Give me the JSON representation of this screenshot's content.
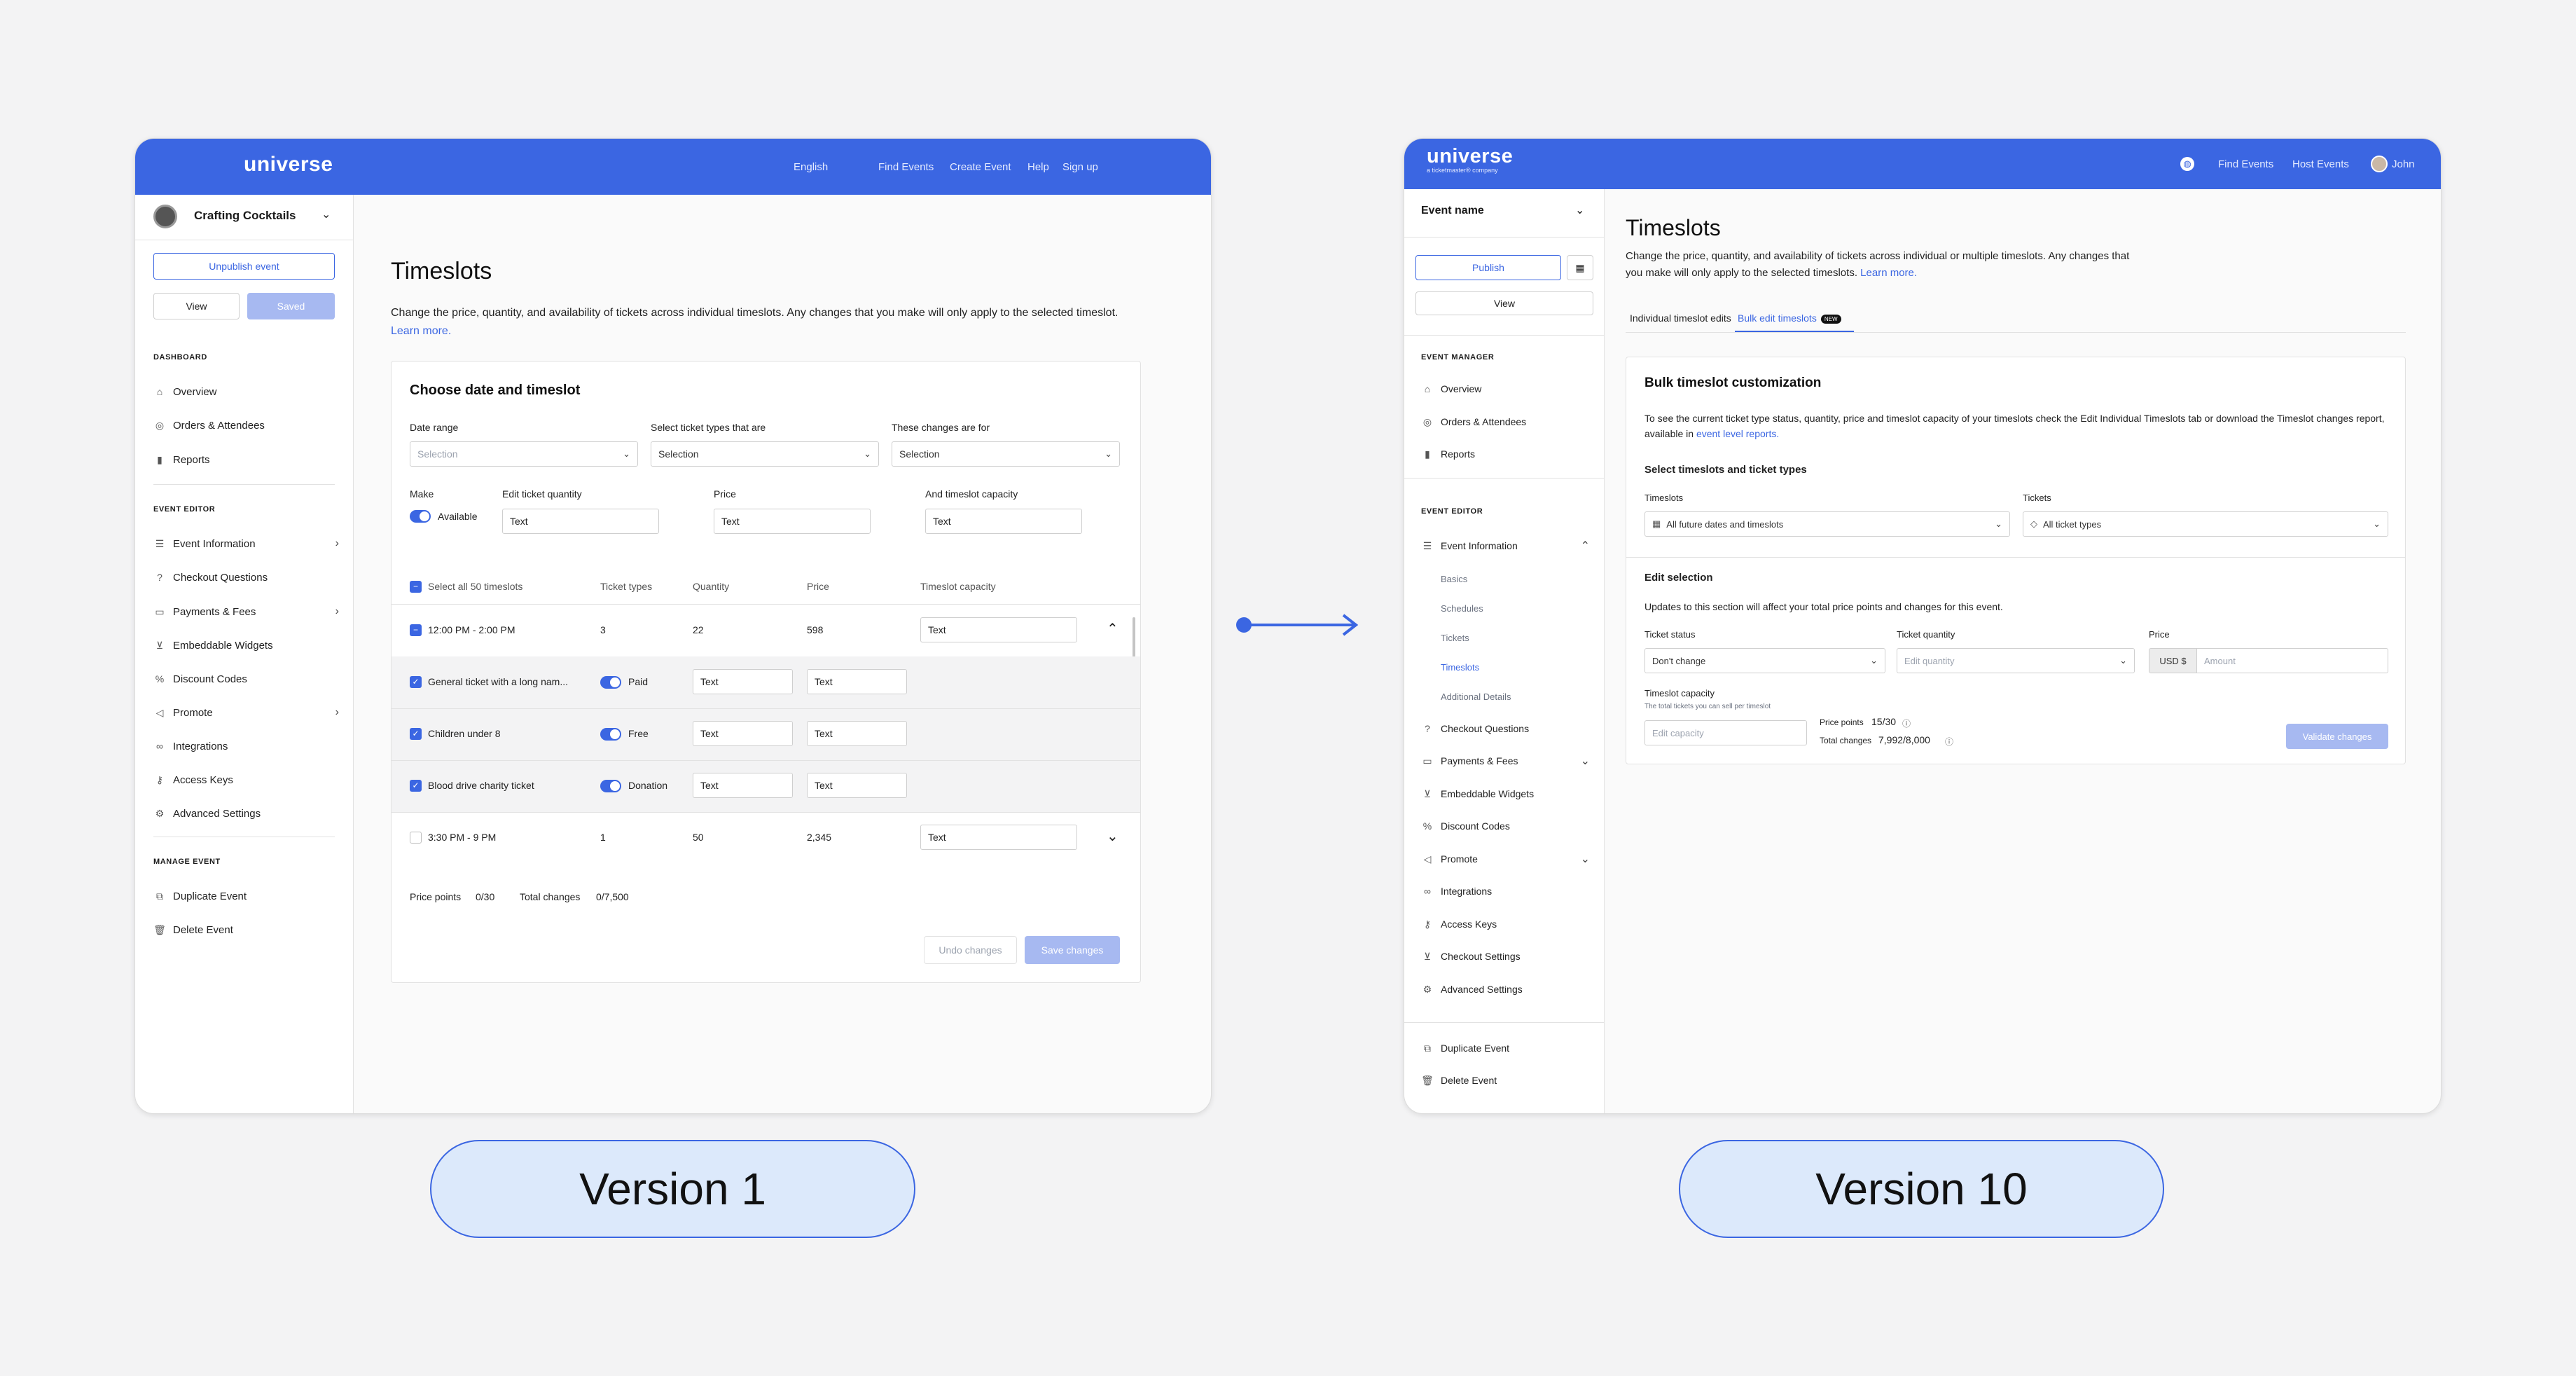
{
  "colors": {
    "accent": "#3b66e2",
    "pill_bg": "#dce9fb",
    "disabled_button": "#a7b9f1"
  },
  "v1": {
    "topbar": {
      "logo": "universe",
      "nav": [
        "English",
        "Find Events",
        "Create Event",
        "Help",
        "Sign up"
      ]
    },
    "sidebar": {
      "event_name": "Crafting Cocktails",
      "unpublish_label": "Unpublish event",
      "view_label": "View",
      "saved_label": "Saved",
      "dashboard_heading": "DASHBOARD",
      "dashboard_items": [
        "Overview",
        "Orders & Attendees",
        "Reports"
      ],
      "editor_heading": "EVENT EDITOR",
      "editor_items": [
        "Event Information",
        "Checkout Questions",
        "Payments & Fees",
        "Embeddable Widgets",
        "Discount Codes",
        "Promote",
        "Integrations",
        "Access Keys",
        "Advanced Settings"
      ],
      "manage_heading": "MANAGE EVENT",
      "manage_items": [
        "Duplicate Event",
        "Delete Event"
      ]
    },
    "main": {
      "title": "Timeslots",
      "description": "Change the price, quantity, and availability of tickets across individual timeslots. Any changes that you make will only apply to the selected timeslot.",
      "learn_more": "Learn more.",
      "card_title": "Choose date and timeslot",
      "filters": [
        {
          "label": "Date range",
          "value": "Selection"
        },
        {
          "label": "Select ticket types that are",
          "value": "Selection"
        },
        {
          "label": "These changes are for",
          "value": "Selection"
        }
      ],
      "make_label": "Make",
      "available_label": "Available",
      "edit_qty_label": "Edit ticket quantity",
      "price_label": "Price",
      "capacity_label": "And timeslot capacity",
      "text_value": "Text",
      "table_headers": [
        "Select all 50 timeslots",
        "Ticket types",
        "Quantity",
        "Price",
        "Timeslot capacity"
      ],
      "timeslot_rows": [
        {
          "time": "12:00 PM - 2:00 PM",
          "types": "3",
          "quantity": "22",
          "price": "598",
          "capacity": "Text"
        },
        {
          "time": "3:30 PM - 9 PM",
          "types": "1",
          "quantity": "50",
          "price": "2,345",
          "capacity": "Text"
        }
      ],
      "ticket_rows": [
        {
          "name": "General ticket with a long nam...",
          "kind": "Paid",
          "quantity": "Text",
          "price": "Text"
        },
        {
          "name": "Children under 8",
          "kind": "Free",
          "quantity": "Text",
          "price": "Text"
        },
        {
          "name": "Blood drive charity ticket",
          "kind": "Donation",
          "quantity": "Text",
          "price": "Text"
        }
      ],
      "price_points_label": "Price points",
      "price_points_value": "0/30",
      "total_changes_label": "Total changes",
      "total_changes_value": "0/7,500",
      "undo_label": "Undo changes",
      "save_label": "Save changes"
    }
  },
  "v10": {
    "topbar": {
      "logo": "universe",
      "logo_sub": "a ticketmaster® company",
      "nav": [
        "Find Events",
        "Host Events"
      ],
      "user": "John"
    },
    "sidebar": {
      "event_name": "Event name",
      "publish_label": "Publish",
      "view_label": "View",
      "manager_heading": "EVENT MANAGER",
      "manager_items": [
        "Overview",
        "Orders & Attendees",
        "Reports"
      ],
      "editor_heading": "EVENT EDITOR",
      "event_information": "Event Information",
      "sub_items": [
        "Basics",
        "Schedules",
        "Tickets",
        "Timeslots",
        "Additional Details"
      ],
      "editor_items": [
        "Checkout Questions",
        "Payments & Fees",
        "Embeddable Widgets",
        "Discount Codes",
        "Promote",
        "Integrations",
        "Access Keys",
        "Checkout Settings",
        "Advanced Settings"
      ],
      "bottom_items": [
        "Duplicate Event",
        "Delete Event"
      ]
    },
    "main": {
      "title": "Timeslots",
      "description": "Change the price, quantity, and availability of tickets across individual or multiple timeslots. Any changes that you make will only apply to the selected timeslots.",
      "learn_more": "Learn more.",
      "tabs": [
        "Individual timeslot edits",
        "Bulk edit timeslots"
      ],
      "tab_badge": "NEW",
      "card_title": "Bulk timeslot customization",
      "card_desc": "To see the current ticket type status, quantity, price and timeslot capacity of your timeslots check the Edit Individual Timeslots tab or download the Timeslot changes report, available in",
      "card_link": "event level reports.",
      "select_heading": "Select timeslots and ticket types",
      "timeslots_label": "Timeslots",
      "timeslots_value": "All future dates and timeslots",
      "tickets_label": "Tickets",
      "tickets_value": "All ticket types",
      "edit_heading": "Edit selection",
      "edit_desc": "Updates to this section will affect your total price points and changes for this event.",
      "status_label": "Ticket status",
      "status_value": "Don't change",
      "qty_label": "Ticket quantity",
      "qty_placeholder": "Edit quantity",
      "price_label": "Price",
      "currency": "USD $",
      "amount_placeholder": "Amount",
      "capacity_label": "Timeslot capacity",
      "capacity_hint": "The total tickets you can sell per timeslot",
      "capacity_placeholder": "Edit capacity",
      "price_points_label": "Price points",
      "price_points_value": "15/30",
      "total_changes_label": "Total changes",
      "total_changes_value": "7,992/8,000",
      "validate_label": "Validate changes"
    }
  },
  "labels": {
    "version_1": "Version 1",
    "version_10": "Version 10"
  }
}
